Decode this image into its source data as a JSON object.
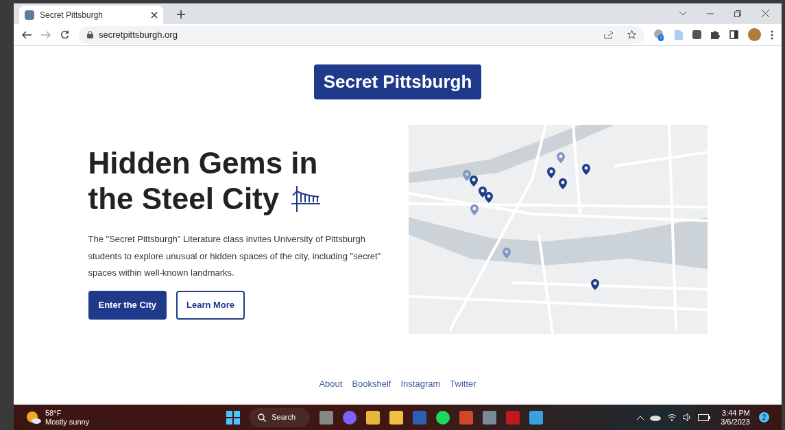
{
  "browser": {
    "tab": {
      "title": "Secret Pittsburgh"
    },
    "url": "secretpittsburgh.org",
    "extension_badge": "?"
  },
  "page": {
    "logo": "Secret Pittsburgh",
    "heading_lines": [
      "Hidden Gems in",
      "the Steel City"
    ],
    "description": "The \"Secret Pittsburgh\" Literature class invites University of Pittsburgh students to explore unusual or hidden spaces of the city, including \"secret\" spaces within well-known landmarks.",
    "buttons": [
      {
        "label": "Enter the City",
        "kind": "primary"
      },
      {
        "label": "Learn More",
        "kind": "outline"
      }
    ],
    "footer_links": [
      "About",
      "Bookshelf",
      "Instagram",
      "Twitter"
    ]
  },
  "taskbar": {
    "weather": {
      "temperature": "58°F",
      "condition": "Mostly sunny"
    },
    "search": "Search",
    "time": "3:44 PM",
    "date": "3/6/2023",
    "notifications": "2"
  }
}
